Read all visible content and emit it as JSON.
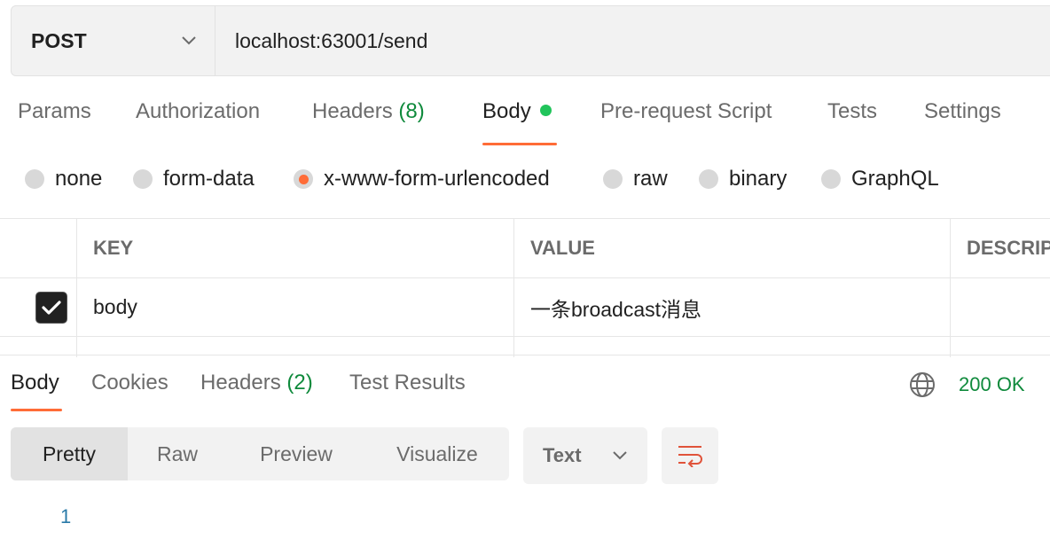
{
  "request": {
    "method": "POST",
    "url": "localhost:63001/send"
  },
  "request_tabs": [
    {
      "label": "Params"
    },
    {
      "label": "Authorization"
    },
    {
      "label": "Headers",
      "count": "(8)"
    },
    {
      "label": "Body",
      "active": true,
      "indicator": "green-dot"
    },
    {
      "label": "Pre-request Script"
    },
    {
      "label": "Tests"
    },
    {
      "label": "Settings"
    }
  ],
  "body_modes": [
    {
      "label": "none"
    },
    {
      "label": "form-data"
    },
    {
      "label": "x-www-form-urlencoded",
      "selected": true
    },
    {
      "label": "raw"
    },
    {
      "label": "binary"
    },
    {
      "label": "GraphQL"
    }
  ],
  "params_table": {
    "headers": [
      "KEY",
      "VALUE",
      "DESCRIP"
    ],
    "rows": [
      {
        "checked": true,
        "key": "body",
        "value": "一条broadcast消息",
        "description": ""
      }
    ]
  },
  "response_tabs": [
    {
      "label": "Body",
      "active": true
    },
    {
      "label": "Cookies"
    },
    {
      "label": "Headers",
      "count": "(2)"
    },
    {
      "label": "Test Results"
    }
  ],
  "response": {
    "status": "200 OK",
    "view_modes": [
      "Pretty",
      "Raw",
      "Preview",
      "Visualize"
    ],
    "active_view": "Pretty",
    "format": "Text",
    "line_numbers": [
      "1"
    ]
  },
  "colors": {
    "accent": "#ff6c37",
    "success": "#0f8a3c",
    "indicator": "#21c45b"
  }
}
